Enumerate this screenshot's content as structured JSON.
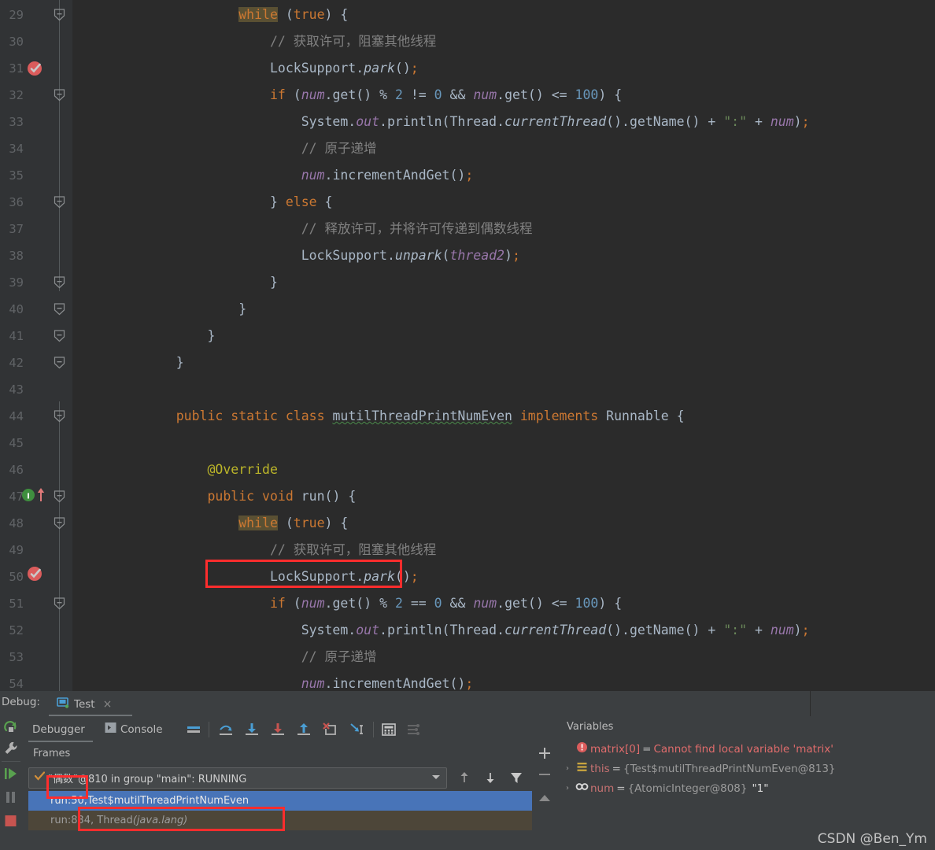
{
  "editor": {
    "first_line": 29,
    "lines": [
      {
        "n": 29,
        "fold": "end",
        "indent": 3
      },
      {
        "n": 30,
        "fold": "none",
        "indent": 4
      },
      {
        "n": 31,
        "fold": "none",
        "indent": 4,
        "state": "breakpoint"
      },
      {
        "n": 32,
        "fold": "end",
        "indent": 4
      },
      {
        "n": 33,
        "fold": "none",
        "indent": 5
      },
      {
        "n": 34,
        "fold": "none",
        "indent": 5
      },
      {
        "n": 35,
        "fold": "none",
        "indent": 5
      },
      {
        "n": 36,
        "fold": "end",
        "indent": 4
      },
      {
        "n": 37,
        "fold": "none",
        "indent": 5
      },
      {
        "n": 38,
        "fold": "none",
        "indent": 5
      },
      {
        "n": 39,
        "fold": "tail",
        "indent": 4
      },
      {
        "n": 40,
        "fold": "tail",
        "indent": 3
      },
      {
        "n": 41,
        "fold": "tail",
        "indent": 2
      },
      {
        "n": 42,
        "fold": "tail",
        "indent": 1
      },
      {
        "n": 43,
        "fold": "none",
        "indent": 0
      },
      {
        "n": 44,
        "fold": "end",
        "indent": 1
      },
      {
        "n": 45,
        "fold": "none",
        "indent": 0
      },
      {
        "n": 46,
        "fold": "none",
        "indent": 2
      },
      {
        "n": 47,
        "fold": "end",
        "indent": 2
      },
      {
        "n": 48,
        "fold": "end",
        "indent": 3
      },
      {
        "n": 49,
        "fold": "none",
        "indent": 4
      },
      {
        "n": 50,
        "fold": "none",
        "indent": 4,
        "state": "execution"
      },
      {
        "n": 51,
        "fold": "end",
        "indent": 4
      },
      {
        "n": 52,
        "fold": "none",
        "indent": 5
      },
      {
        "n": 53,
        "fold": "none",
        "indent": 5
      },
      {
        "n": 54,
        "fold": "none",
        "indent": 5
      }
    ],
    "code": {
      "l29": "while (true) {",
      "l30": "// 获取许可，阻塞其他线程",
      "l31": "LockSupport.park();",
      "l32": "if (num.get() % 2 != 0 && num.get() <= 100) {",
      "l33": "System.out.println(Thread.currentThread().getName() + \":\" + num);",
      "l34": "// 原子递增",
      "l35": "num.incrementAndGet();",
      "l36": "} else {",
      "l37": "// 释放许可，并将许可传递到偶数线程",
      "l38": "LockSupport.unpark(thread2);",
      "l39": "}",
      "l40": "}",
      "l41": "}",
      "l42": "}",
      "l43": "",
      "l44": "public static class mutilThreadPrintNumEven implements Runnable {",
      "l45": "",
      "l46": "@Override",
      "l47": "public void run() {",
      "l48": "while (true) {",
      "l49": "// 获取许可，阻塞其他线程",
      "l50": "LockSupport.park();",
      "l51": "if (num.get() % 2 == 0 && num.get() <= 100) {",
      "l52": "System.out.println(Thread.currentThread().getName() + \":\" + num);",
      "l53": "// 原子递增",
      "l54": "num.incrementAndGet();"
    },
    "class_name": "mutilThreadPrintNumEven",
    "colors": {
      "background": "#2b2b2b",
      "gutter": "#313335",
      "keyword": "#cc7832",
      "comment": "#808080",
      "string": "#6a8759",
      "number": "#6897bb",
      "field": "#9876aa",
      "annotation": "#bbb529",
      "plain": "#a9b7c6",
      "breakpoint_row": "#3b2526",
      "execution_row": "#3170b3",
      "highlight_box": "#ff2d2d"
    }
  },
  "debug": {
    "label": "Debug:",
    "tab": {
      "title": "Test",
      "close": "×",
      "icon": "run-config-icon"
    },
    "left_toolbar": [
      {
        "name": "rerun-icon",
        "title": "Rerun"
      },
      {
        "name": "settings-wrench-icon",
        "title": "Settings"
      },
      {
        "name": "resume-program-icon",
        "title": "Resume Program"
      },
      {
        "name": "pause-program-icon",
        "title": "Pause Program"
      },
      {
        "name": "stop-icon",
        "title": "Stop"
      }
    ],
    "tabs": [
      {
        "label": "Debugger",
        "icon": "",
        "active": true
      },
      {
        "label": "Console",
        "icon": "console-icon",
        "active": false
      }
    ],
    "toolbar_icons": [
      {
        "name": "show-execution-point-icon"
      },
      {
        "name": "step-over-icon"
      },
      {
        "name": "step-into-icon"
      },
      {
        "name": "force-step-into-icon"
      },
      {
        "name": "step-out-icon"
      },
      {
        "name": "drop-frame-icon"
      },
      {
        "name": "run-to-cursor-icon"
      },
      {
        "name": "evaluate-expression-icon"
      },
      {
        "name": "settings-list-icon"
      }
    ],
    "frames": {
      "header": "Frames",
      "thread_selector": "\"偶数\"@810 in group \"main\": RUNNING",
      "thread_marker": "✓",
      "buttons": [
        "up-arrow-icon",
        "down-arrow-icon",
        "filter-icon"
      ],
      "rows": [
        {
          "text_a": "run:50, ",
          "text_b": "Test$mutilThreadPrintNumEven",
          "selected": true
        },
        {
          "text_a": "run:834, Thread ",
          "text_b": "(java.lang)",
          "italic_b": true,
          "selected": false
        }
      ],
      "side_buttons": [
        "add-icon",
        "remove-icon",
        "collapse-icon"
      ]
    },
    "variables": {
      "header": "Variables",
      "rows": [
        {
          "chevron": "",
          "icon": "error-icon",
          "name": "matrix[0]",
          "eq": "=",
          "value": "Cannot find local variable 'matrix'",
          "error": true
        },
        {
          "chevron": "›",
          "icon": "object-icon",
          "name": "this",
          "eq": "=",
          "value": "{Test$mutilThreadPrintNumEven@813}",
          "error": false
        },
        {
          "chevron": "›",
          "icon": "link-icon",
          "name": "num",
          "eq": "=",
          "value": "{AtomicInteger@808}",
          "extra": "\"1\"",
          "error": false
        }
      ]
    }
  },
  "watermark": "CSDN @Ben_Ym"
}
